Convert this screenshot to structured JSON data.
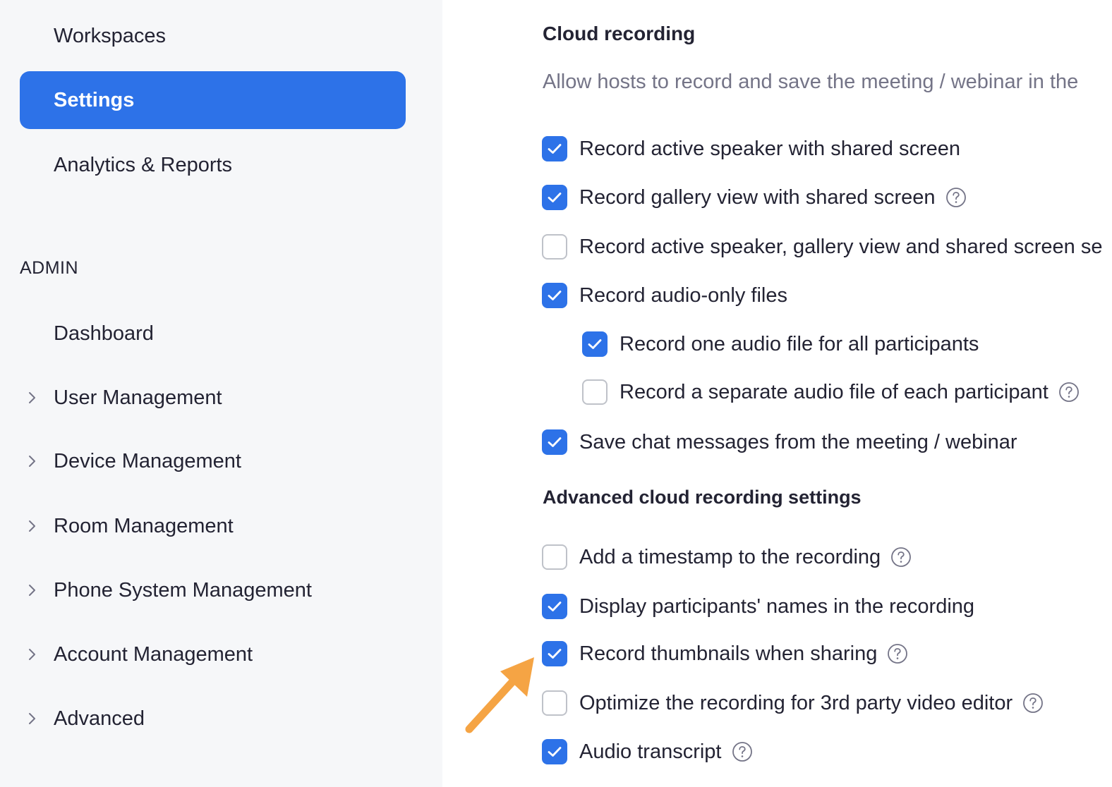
{
  "sidebar": {
    "items": [
      {
        "label": "Workspaces"
      },
      {
        "label": "Settings"
      },
      {
        "label": "Analytics & Reports"
      }
    ],
    "admin_label": "ADMIN",
    "admin_items": [
      {
        "label": "Dashboard"
      },
      {
        "label": "User Management"
      },
      {
        "label": "Device Management"
      },
      {
        "label": "Room Management"
      },
      {
        "label": "Phone System Management"
      },
      {
        "label": "Account Management"
      },
      {
        "label": "Advanced"
      }
    ]
  },
  "main": {
    "title": "Cloud recording",
    "description": "Allow hosts to record and save the meeting / webinar in the",
    "options": [
      {
        "label": "Record active speaker with shared screen",
        "checked": true
      },
      {
        "label": "Record gallery view with shared screen",
        "checked": true
      },
      {
        "label": "Record active speaker, gallery view and shared screen se",
        "checked": false
      },
      {
        "label": "Record audio-only files",
        "checked": true
      },
      {
        "label": "Record one audio file for all participants",
        "checked": true
      },
      {
        "label": "Record a separate audio file of each participant",
        "checked": false
      },
      {
        "label": "Save chat messages from the meeting / webinar",
        "checked": true
      }
    ],
    "advanced_title": "Advanced cloud recording settings",
    "advanced_options": [
      {
        "label": "Add a timestamp to the recording",
        "checked": false
      },
      {
        "label": "Display participants' names in the recording",
        "checked": true
      },
      {
        "label": "Record thumbnails when sharing",
        "checked": true
      },
      {
        "label": "Optimize the recording for 3rd party video editor",
        "checked": false
      },
      {
        "label": "Audio transcript",
        "checked": true
      }
    ]
  },
  "colors": {
    "accent": "#2d72e8",
    "sidebar_bg": "#f6f7f9",
    "annotation_arrow": "#f5a444"
  },
  "icons": {
    "checkbox_checked": "check-icon",
    "help": "help-icon",
    "nav_expand": "chevron-right-icon",
    "annotation": "arrow-icon"
  }
}
